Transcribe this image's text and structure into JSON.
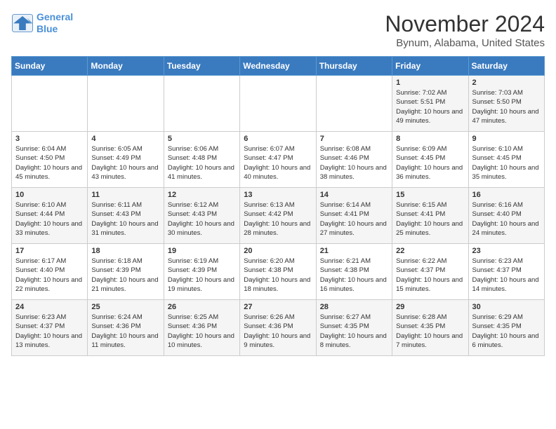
{
  "logo": {
    "line1": "General",
    "line2": "Blue"
  },
  "title": "November 2024",
  "subtitle": "Bynum, Alabama, United States",
  "days_of_week": [
    "Sunday",
    "Monday",
    "Tuesday",
    "Wednesday",
    "Thursday",
    "Friday",
    "Saturday"
  ],
  "weeks": [
    [
      {
        "day": "",
        "info": ""
      },
      {
        "day": "",
        "info": ""
      },
      {
        "day": "",
        "info": ""
      },
      {
        "day": "",
        "info": ""
      },
      {
        "day": "",
        "info": ""
      },
      {
        "day": "1",
        "info": "Sunrise: 7:02 AM\nSunset: 5:51 PM\nDaylight: 10 hours and 49 minutes."
      },
      {
        "day": "2",
        "info": "Sunrise: 7:03 AM\nSunset: 5:50 PM\nDaylight: 10 hours and 47 minutes."
      }
    ],
    [
      {
        "day": "3",
        "info": "Sunrise: 6:04 AM\nSunset: 4:50 PM\nDaylight: 10 hours and 45 minutes."
      },
      {
        "day": "4",
        "info": "Sunrise: 6:05 AM\nSunset: 4:49 PM\nDaylight: 10 hours and 43 minutes."
      },
      {
        "day": "5",
        "info": "Sunrise: 6:06 AM\nSunset: 4:48 PM\nDaylight: 10 hours and 41 minutes."
      },
      {
        "day": "6",
        "info": "Sunrise: 6:07 AM\nSunset: 4:47 PM\nDaylight: 10 hours and 40 minutes."
      },
      {
        "day": "7",
        "info": "Sunrise: 6:08 AM\nSunset: 4:46 PM\nDaylight: 10 hours and 38 minutes."
      },
      {
        "day": "8",
        "info": "Sunrise: 6:09 AM\nSunset: 4:45 PM\nDaylight: 10 hours and 36 minutes."
      },
      {
        "day": "9",
        "info": "Sunrise: 6:10 AM\nSunset: 4:45 PM\nDaylight: 10 hours and 35 minutes."
      }
    ],
    [
      {
        "day": "10",
        "info": "Sunrise: 6:10 AM\nSunset: 4:44 PM\nDaylight: 10 hours and 33 minutes."
      },
      {
        "day": "11",
        "info": "Sunrise: 6:11 AM\nSunset: 4:43 PM\nDaylight: 10 hours and 31 minutes."
      },
      {
        "day": "12",
        "info": "Sunrise: 6:12 AM\nSunset: 4:43 PM\nDaylight: 10 hours and 30 minutes."
      },
      {
        "day": "13",
        "info": "Sunrise: 6:13 AM\nSunset: 4:42 PM\nDaylight: 10 hours and 28 minutes."
      },
      {
        "day": "14",
        "info": "Sunrise: 6:14 AM\nSunset: 4:41 PM\nDaylight: 10 hours and 27 minutes."
      },
      {
        "day": "15",
        "info": "Sunrise: 6:15 AM\nSunset: 4:41 PM\nDaylight: 10 hours and 25 minutes."
      },
      {
        "day": "16",
        "info": "Sunrise: 6:16 AM\nSunset: 4:40 PM\nDaylight: 10 hours and 24 minutes."
      }
    ],
    [
      {
        "day": "17",
        "info": "Sunrise: 6:17 AM\nSunset: 4:40 PM\nDaylight: 10 hours and 22 minutes."
      },
      {
        "day": "18",
        "info": "Sunrise: 6:18 AM\nSunset: 4:39 PM\nDaylight: 10 hours and 21 minutes."
      },
      {
        "day": "19",
        "info": "Sunrise: 6:19 AM\nSunset: 4:39 PM\nDaylight: 10 hours and 19 minutes."
      },
      {
        "day": "20",
        "info": "Sunrise: 6:20 AM\nSunset: 4:38 PM\nDaylight: 10 hours and 18 minutes."
      },
      {
        "day": "21",
        "info": "Sunrise: 6:21 AM\nSunset: 4:38 PM\nDaylight: 10 hours and 16 minutes."
      },
      {
        "day": "22",
        "info": "Sunrise: 6:22 AM\nSunset: 4:37 PM\nDaylight: 10 hours and 15 minutes."
      },
      {
        "day": "23",
        "info": "Sunrise: 6:23 AM\nSunset: 4:37 PM\nDaylight: 10 hours and 14 minutes."
      }
    ],
    [
      {
        "day": "24",
        "info": "Sunrise: 6:23 AM\nSunset: 4:37 PM\nDaylight: 10 hours and 13 minutes."
      },
      {
        "day": "25",
        "info": "Sunrise: 6:24 AM\nSunset: 4:36 PM\nDaylight: 10 hours and 11 minutes."
      },
      {
        "day": "26",
        "info": "Sunrise: 6:25 AM\nSunset: 4:36 PM\nDaylight: 10 hours and 10 minutes."
      },
      {
        "day": "27",
        "info": "Sunrise: 6:26 AM\nSunset: 4:36 PM\nDaylight: 10 hours and 9 minutes."
      },
      {
        "day": "28",
        "info": "Sunrise: 6:27 AM\nSunset: 4:35 PM\nDaylight: 10 hours and 8 minutes."
      },
      {
        "day": "29",
        "info": "Sunrise: 6:28 AM\nSunset: 4:35 PM\nDaylight: 10 hours and 7 minutes."
      },
      {
        "day": "30",
        "info": "Sunrise: 6:29 AM\nSunset: 4:35 PM\nDaylight: 10 hours and 6 minutes."
      }
    ]
  ]
}
